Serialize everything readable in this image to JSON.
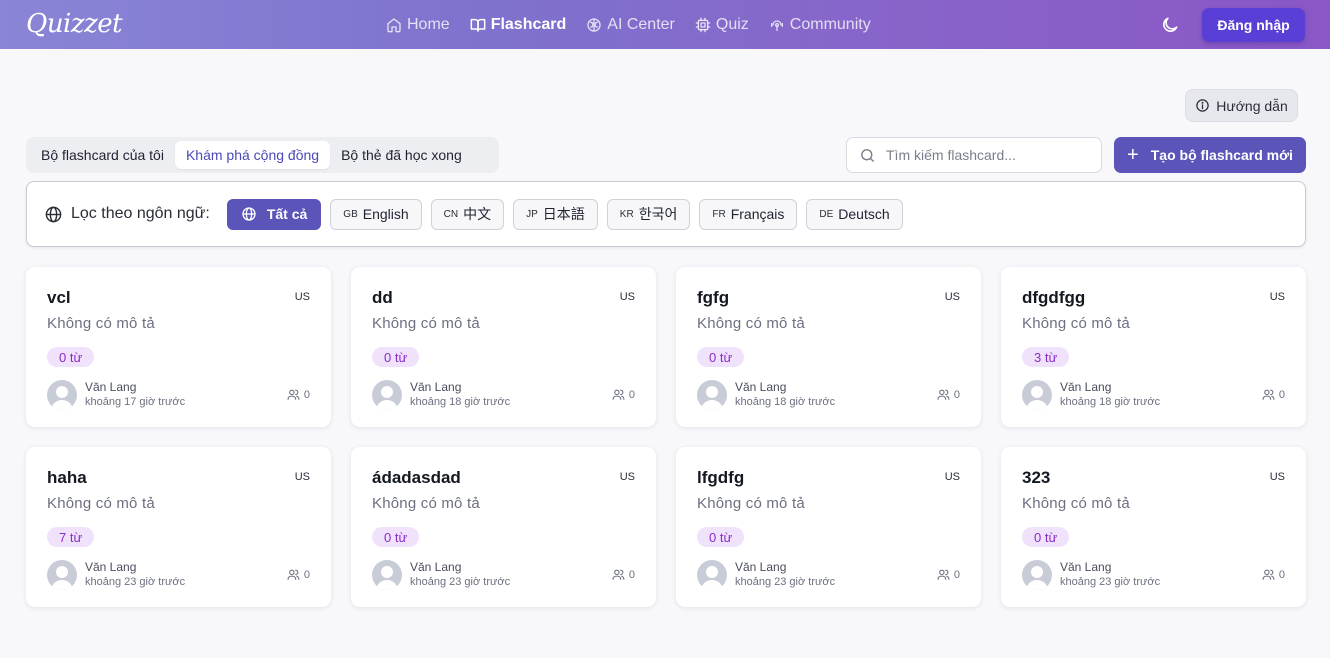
{
  "header": {
    "logo": "Quizzet",
    "nav": [
      {
        "label": "Home",
        "icon": "home-icon",
        "active": false
      },
      {
        "label": "Flashcard",
        "icon": "book-open-icon",
        "active": true
      },
      {
        "label": "AI Center",
        "icon": "brain-icon",
        "active": false
      },
      {
        "label": "Quiz",
        "icon": "cpu-icon",
        "active": false
      },
      {
        "label": "Community",
        "icon": "community-icon",
        "active": false
      }
    ],
    "theme_icon": "moon-icon",
    "login_label": "Đăng nhập"
  },
  "guide_label": "Hướng dẫn",
  "tabs": [
    "Bộ flashcard của tôi",
    "Khám phá cộng đồng",
    "Bộ thẻ đã học xong"
  ],
  "active_tab": 1,
  "search": {
    "placeholder": "Tìm kiếm flashcard..."
  },
  "create_label": "Tạo bộ flashcard mới",
  "filter": {
    "label": "Lọc theo ngôn ngữ:",
    "chips": [
      {
        "code": "",
        "label": "Tất cả",
        "active": true
      },
      {
        "code": "GB",
        "label": "English",
        "active": false
      },
      {
        "code": "CN",
        "label": "中文",
        "active": false
      },
      {
        "code": "JP",
        "label": "日本語",
        "active": false
      },
      {
        "code": "KR",
        "label": "한국어",
        "active": false
      },
      {
        "code": "FR",
        "label": "Français",
        "active": false
      },
      {
        "code": "DE",
        "label": "Deutsch",
        "active": false
      }
    ]
  },
  "cards": [
    {
      "title": "vcl",
      "lang": "US",
      "desc": "Không có mô tả",
      "count": "0 từ",
      "author": "Văn Lang",
      "time": "khoảng 17 giờ trước",
      "members": "0"
    },
    {
      "title": "dd",
      "lang": "US",
      "desc": "Không có mô tả",
      "count": "0 từ",
      "author": "Văn Lang",
      "time": "khoảng 18 giờ trước",
      "members": "0"
    },
    {
      "title": "fgfg",
      "lang": "US",
      "desc": "Không có mô tả",
      "count": "0 từ",
      "author": "Văn Lang",
      "time": "khoảng 18 giờ trước",
      "members": "0"
    },
    {
      "title": "dfgdfgg",
      "lang": "US",
      "desc": "Không có mô tả",
      "count": "3 từ",
      "author": "Văn Lang",
      "time": "khoảng 18 giờ trước",
      "members": "0"
    },
    {
      "title": "haha",
      "lang": "US",
      "desc": "Không có mô tả",
      "count": "7 từ",
      "author": "Văn Lang",
      "time": "khoảng 23 giờ trước",
      "members": "0"
    },
    {
      "title": "ádadasdad",
      "lang": "US",
      "desc": "Không có mô tả",
      "count": "0 từ",
      "author": "Văn Lang",
      "time": "khoảng 23 giờ trước",
      "members": "0"
    },
    {
      "title": "lfgdfg",
      "lang": "US",
      "desc": "Không có mô tả",
      "count": "0 từ",
      "author": "Văn Lang",
      "time": "khoảng 23 giờ trước",
      "members": "0"
    },
    {
      "title": "323",
      "lang": "US",
      "desc": "Không có mô tả",
      "count": "0 từ",
      "author": "Văn Lang",
      "time": "khoảng 23 giờ trước",
      "members": "0"
    }
  ],
  "colors": {
    "accent": "#5b54b9",
    "login_button": "#5a3fd6",
    "badge_bg": "#f0e2fb",
    "badge_text": "#8a2cc9"
  }
}
